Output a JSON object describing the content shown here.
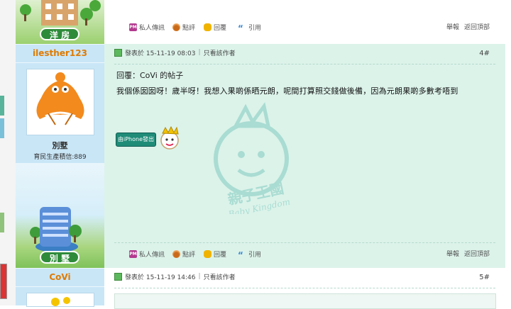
{
  "left_strip": {
    "marks": [
      "green-block",
      "blue-block",
      "green-block",
      "red-block"
    ]
  },
  "sidebar": {
    "house_top_label": "洋 房",
    "user1": {
      "name": "ilesther123",
      "rank": "別墅",
      "stat": "育民生產積信:889"
    },
    "house_mid_label": "別 墅",
    "user2": {
      "name": "CoVi"
    }
  },
  "toolbar_top": {
    "pm": "私人傳訊",
    "bowl": "點評",
    "reply": "回覆",
    "quote": "引用",
    "report": "舉報",
    "back_top": "返回頂部"
  },
  "post4": {
    "posted": "發表於 15-11-19 08:03",
    "author_only": "只看該作者",
    "number": "4#",
    "title": "回覆：CoVi 的帖子",
    "body": "我個係囡囡呀！歲半呀！我想入果啲係晒元朗，呢間打算照交錢做後備，因為元朗果啲多數考唔到",
    "badge": "由iPhone發出",
    "watermark_brand": "親子王國",
    "watermark_sub": "Baby Kingdom",
    "toolbar": {
      "pm": "私人傳訊",
      "bowl": "點評",
      "reply": "回覆",
      "quote": "引用",
      "report": "舉報",
      "back_top": "返回頂部"
    }
  },
  "post5": {
    "posted": "發表於 15-11-19 14:46",
    "author_only": "只看該作者",
    "number": "5#"
  },
  "colors": {
    "post_bg": "#dcf3ea",
    "sidebar_bg": "#c9e6f7",
    "username": "#e07a00"
  }
}
